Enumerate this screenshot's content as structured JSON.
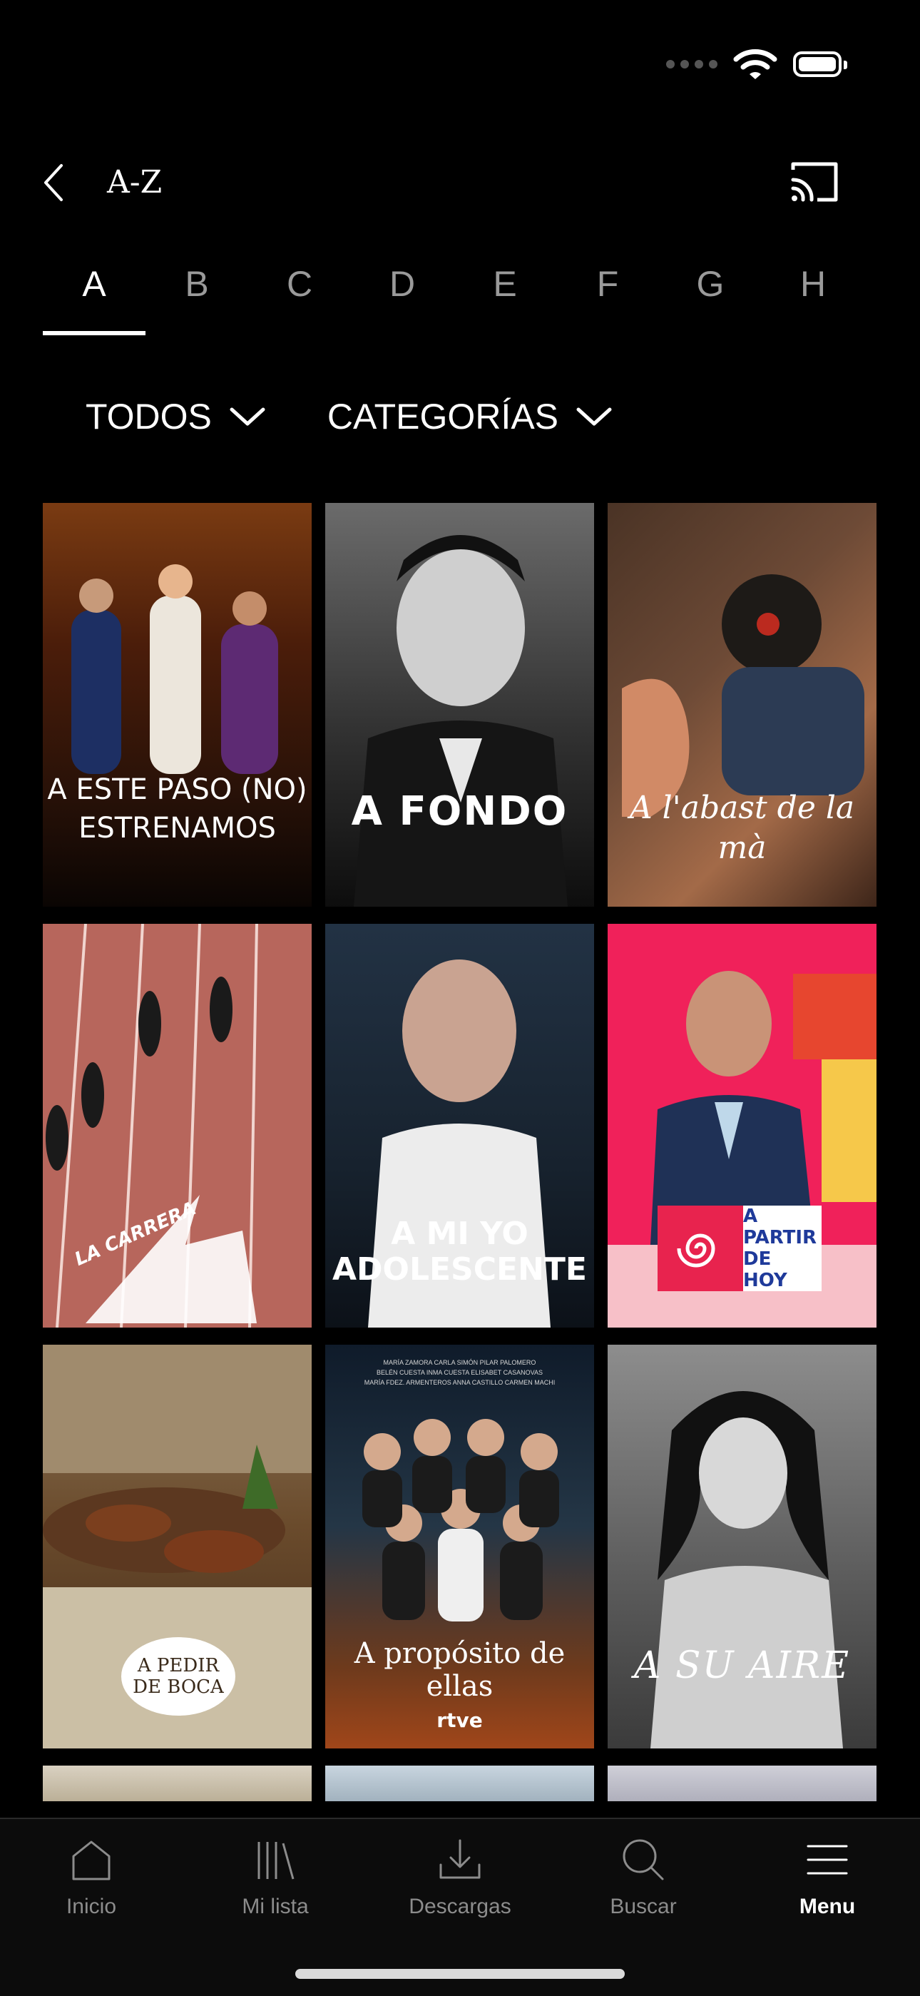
{
  "header": {
    "title": "A-Z"
  },
  "letters": [
    "A",
    "B",
    "C",
    "D",
    "E",
    "F",
    "G",
    "H"
  ],
  "active_letter": "A",
  "filters": [
    {
      "label": "TODOS"
    },
    {
      "label": "CATEGORÍAS"
    }
  ],
  "cards": [
    {
      "title": "A ESTE PASO (NO) ESTRENAMOS"
    },
    {
      "title": "A FONDO"
    },
    {
      "title": "A l'abast de la mà"
    },
    {
      "title": "LA CARRERA"
    },
    {
      "title": "A MI YO ADOLESCENTE"
    },
    {
      "title": "A PARTIR DE HOY"
    },
    {
      "title": "A PEDIR DE BOCA"
    },
    {
      "title": "A propósito de ellas",
      "logo": "rtve",
      "credits_line1": "MARÍA ZAMORA  CARLA SIMÓN  PILAR PALOMERO",
      "credits_line2": "BELÉN CUESTA  INMA CUESTA  ELISABET CASANOVAS",
      "credits_line3": "MARÍA FDEZ. ARMENTEROS  ANNA CASTILLO  CARMEN MACHI"
    },
    {
      "title": "A SU AIRE"
    }
  ],
  "tabbar": [
    {
      "label": "Inicio",
      "icon": "home-icon"
    },
    {
      "label": "Mi lista",
      "icon": "library-icon"
    },
    {
      "label": "Descargas",
      "icon": "download-icon"
    },
    {
      "label": "Buscar",
      "icon": "search-icon"
    },
    {
      "label": "Menu",
      "icon": "menu-icon",
      "active": true
    }
  ],
  "colors": {
    "background": "#000000",
    "active": "#ffffff",
    "inactive": "#8c8c8c"
  }
}
